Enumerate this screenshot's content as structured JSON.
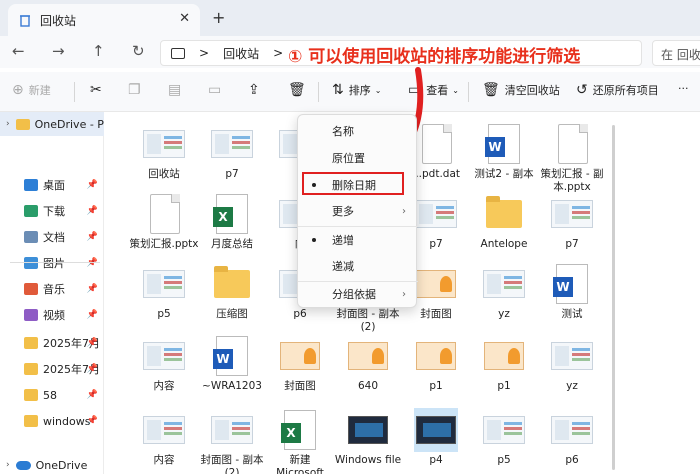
{
  "tab": {
    "title": "回收站",
    "close": "✕",
    "new_tab": "+"
  },
  "address": {
    "back": "←",
    "forward": "→",
    "up": "↑",
    "refresh": "↻",
    "crumb_sep": ">",
    "crumb": "回收站",
    "crumb_sep2": ">",
    "search_placeholder": "在 回收站"
  },
  "annotation": "① 可以使用回收站的排序功能进行筛选",
  "toolbar": {
    "new": "新建",
    "sort": "排序",
    "view": "查看",
    "empty_bin": "清空回收站",
    "restore_all": "还原所有项目",
    "more": "···"
  },
  "sidebar": {
    "onedrive_personal": "OneDrive - P",
    "items": [
      {
        "label": "桌面",
        "color": "#2d7fd6"
      },
      {
        "label": "下载",
        "color": "#2a9d6a"
      },
      {
        "label": "文档",
        "color": "#6b8db5"
      },
      {
        "label": "图片",
        "color": "#3d8fd8"
      },
      {
        "label": "音乐",
        "color": "#e05a3a"
      },
      {
        "label": "视频",
        "color": "#8e5cc5"
      },
      {
        "label": "2025年7月",
        "color": "#f2bf48"
      },
      {
        "label": "2025年7月",
        "color": "#f2bf48"
      },
      {
        "label": "58",
        "color": "#f2bf48"
      },
      {
        "label": "windows",
        "color": "#f2bf48"
      }
    ],
    "onedrive": "OneDrive"
  },
  "menu": {
    "items": [
      "名称",
      "原位置",
      "删除日期",
      "更多",
      "递增",
      "递减",
      "分组依据"
    ]
  },
  "files": [
    {
      "name": "回收站",
      "kind": "shot"
    },
    {
      "name": "p7",
      "kind": "shot"
    },
    {
      "name": "p",
      "kind": "shot"
    },
    {
      "name": "...pdt.dat",
      "kind": "doc"
    },
    {
      "name": "测试2 - 副本",
      "kind": "word"
    },
    {
      "name": "策划汇报 - 副本.pptx",
      "kind": "doc"
    },
    {
      "name": "策划汇报.pptx",
      "kind": "doc"
    },
    {
      "name": "月度总结",
      "kind": "excel"
    },
    {
      "name": "内",
      "kind": "shot"
    },
    {
      "name": "p7",
      "kind": "shot"
    },
    {
      "name": "Antelope",
      "kind": "folder"
    },
    {
      "name": "p7",
      "kind": "shot"
    },
    {
      "name": "p5",
      "kind": "shot"
    },
    {
      "name": "压缩图",
      "kind": "folder"
    },
    {
      "name": "p6",
      "kind": "shot"
    },
    {
      "name": "封面图 - 副本 (2)",
      "kind": "orange"
    },
    {
      "name": "封面图",
      "kind": "orange"
    },
    {
      "name": "yz",
      "kind": "shot"
    },
    {
      "name": "测试",
      "kind": "word"
    },
    {
      "name": "内容",
      "kind": "shot"
    },
    {
      "name": "~WRA1203",
      "kind": "word"
    },
    {
      "name": "封面图",
      "kind": "orange"
    },
    {
      "name": "640",
      "kind": "orange"
    },
    {
      "name": "p1",
      "kind": "orange"
    },
    {
      "name": "p1",
      "kind": "orange"
    },
    {
      "name": "yz",
      "kind": "shot"
    },
    {
      "name": "内容",
      "kind": "shot"
    },
    {
      "name": "封面图 - 副本 (2)",
      "kind": "shot"
    },
    {
      "name": "新建 Microsoft",
      "kind": "excel"
    },
    {
      "name": "Windows file",
      "kind": "dark"
    },
    {
      "name": "p4",
      "kind": "dark"
    },
    {
      "name": "p5",
      "kind": "shot"
    },
    {
      "name": "p6",
      "kind": "shot"
    }
  ]
}
